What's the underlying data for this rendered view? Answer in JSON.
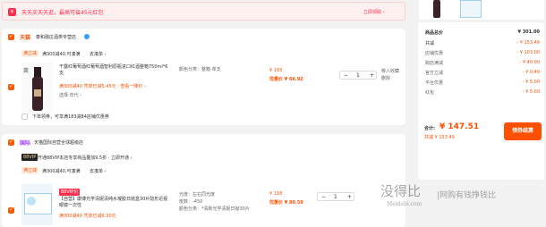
{
  "banner": {
    "text": "天天买天天逛，最高可省45元红包",
    "link": "立即领取 ›"
  },
  "store1": {
    "badge": "天猫",
    "name": "泰和融庄酒类专营店",
    "promo_tag": "满立减",
    "promo_text": "满300减40,可凑满",
    "promo_link": "去凑单 ›",
    "item": {
      "title": "干露红葡萄酒红葡萄酒智利原瓶进口红酒整箱750ml*6支",
      "tags": "满300减40 凭单已减5.45元 · 查看一降价 ›",
      "sub": "选择·年代 ›",
      "spec": "颜色分类：整箱·单支",
      "orig_price": "¥ 183",
      "coupon_price": "优惠价 ¥ 66.92",
      "qty": "1",
      "ops": [
        "移入收藏",
        "删除"
      ]
    },
    "footer": "下单领券，可享满183减84店铺优惠券"
  },
  "store2": {
    "badge": "国际",
    "name": "天猫国际自营全球超级店",
    "promo_text": "开通88VIP本店专享商品叠加9.5折 · 立即开通 ›",
    "promo_tag": "满立减",
    "promo_text2": "满300减40,可凑满",
    "promo_link": "去凑单 ›",
    "item": {
      "label": "88VIP价",
      "title": "【自营】康博光学清妮清纯水凝胶日抛盒30片隐形近视眼镜一次性",
      "tags": "满300减40 凭单已减6.30元",
      "spec_lines": [
        "光度：左右同光度",
        "度数：-450",
        "颜色分类：*清新光学清妮日抛30片"
      ],
      "orig_price": "¥ 118",
      "coupon_price": "优惠价 ¥ 80.59",
      "qty": "1"
    }
  },
  "summary": {
    "title": "商品总价",
    "total": "¥ 301.00",
    "discount_label": "共减",
    "discount": "- ¥ 153.49",
    "rows": [
      {
        "label": "店铺优惠",
        "value": "- ¥ 103.00"
      },
      {
        "label": "跨店满减",
        "value": "- ¥ 40.00"
      },
      {
        "label": "官方立减",
        "value": "- ¥ 0.49"
      },
      {
        "label": "平台优惠",
        "value": "- ¥ 5.00"
      },
      {
        "label": "红包",
        "value": "- ¥ 5.00"
      }
    ],
    "sum_label": "合计:",
    "sum_value": "¥ 147.51",
    "sum_sub": "共减 ¥ 153.49",
    "checkout": "领券结算",
    "select_label": "已选"
  },
  "watermark": {
    "big": "没得比",
    "sub": "Meidebi.com",
    "slogan": "|网购有钱挣钱比"
  }
}
